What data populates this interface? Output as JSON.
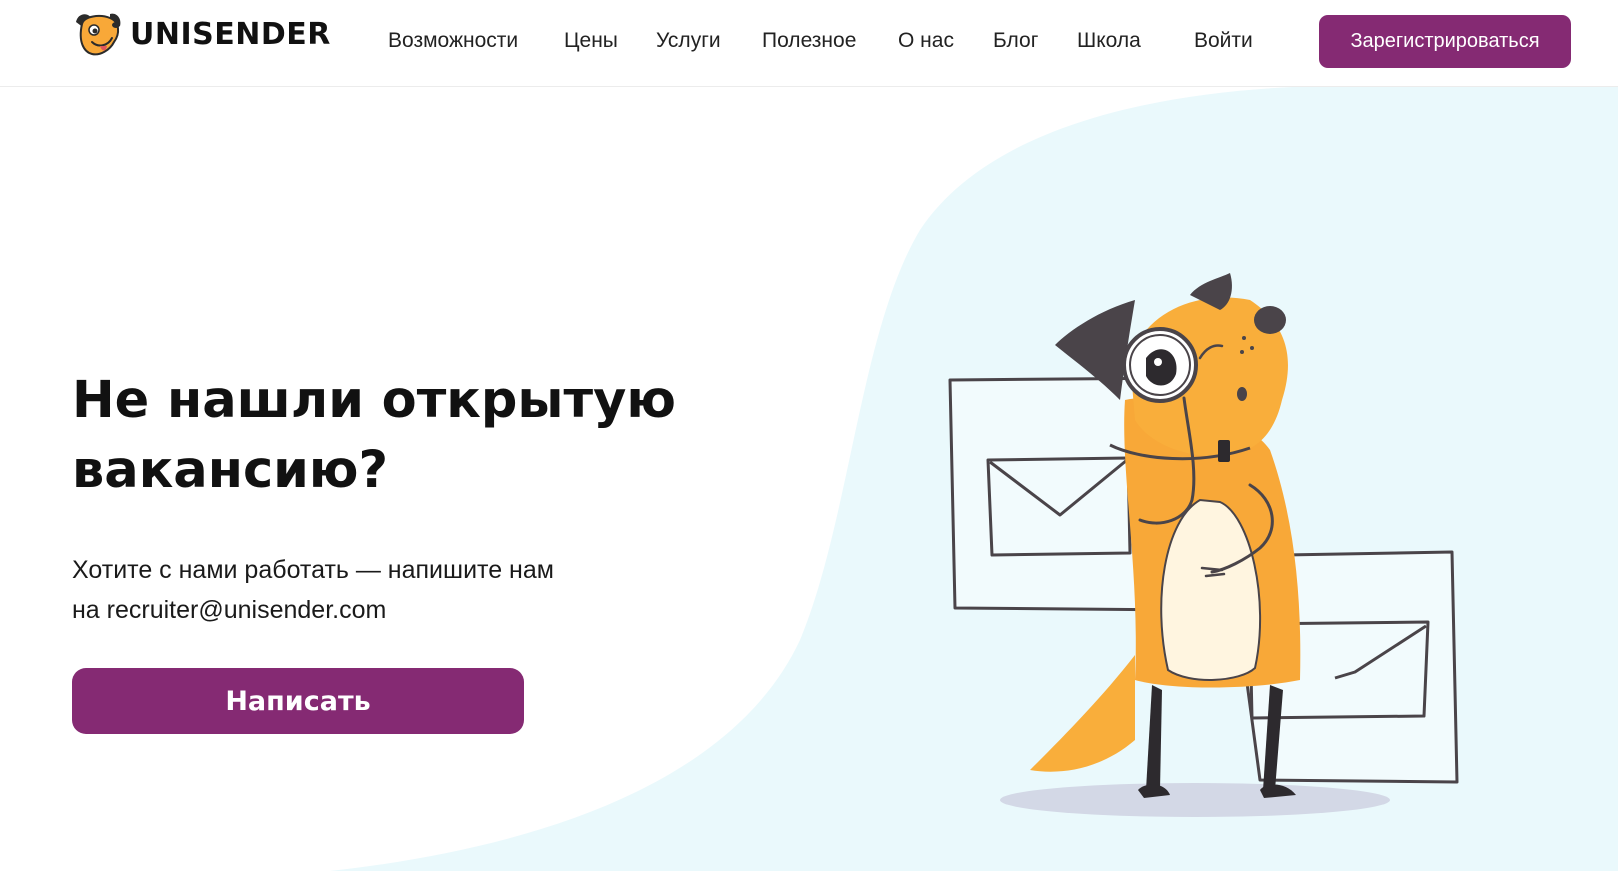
{
  "header": {
    "logo_text": "UNISENDER",
    "nav": [
      {
        "label": "Возможности"
      },
      {
        "label": "Цены"
      },
      {
        "label": "Услуги"
      },
      {
        "label": "Полезное"
      },
      {
        "label": "О нас"
      },
      {
        "label": "Блог"
      },
      {
        "label": "Школа"
      }
    ],
    "login_label": "Войти",
    "register_label": "Зарегистрироваться"
  },
  "hero": {
    "title_line1": "Не нашли открытую",
    "title_line2": "вакансию?",
    "subtitle_line1": "Хотите с нами работать — напишите нам",
    "subtitle_line2": "на recruiter@unisender.com",
    "button_label": "Написать"
  },
  "illustration": {
    "subject": "dog-with-magnifying-glass-and-envelopes"
  },
  "colors": {
    "brand_purple": "#852a73",
    "background_blob": "#eaf9fc",
    "dog_orange": "#f8a838",
    "outline": "#4a4449"
  }
}
